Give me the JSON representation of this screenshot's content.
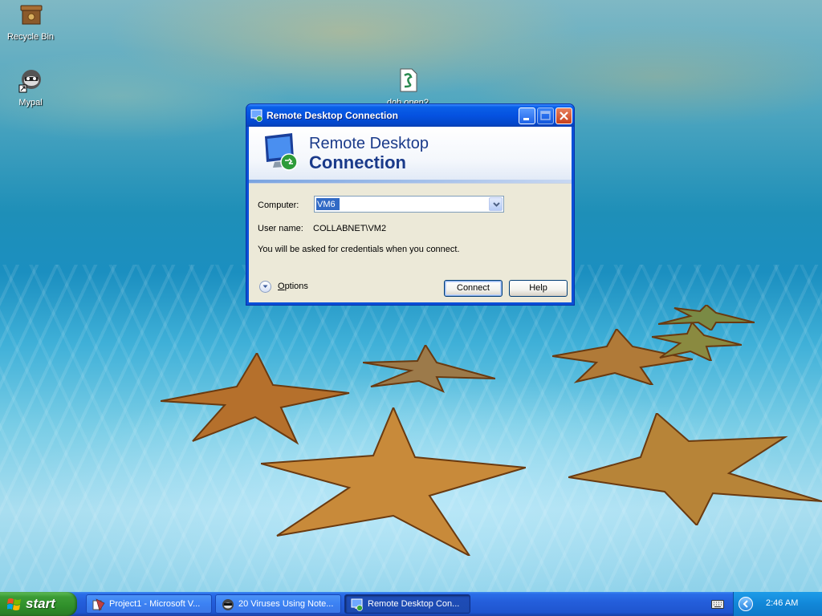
{
  "desktop": {
    "icons": [
      {
        "label": "Recycle Bin",
        "icon": "recycle-bin-icon"
      },
      {
        "label": "Mypal",
        "icon": "mypal-icon"
      },
      {
        "label": "doh.open?",
        "icon": "script-file-icon"
      }
    ]
  },
  "dialog": {
    "title": "Remote Desktop Connection",
    "banner_line1": "Remote Desktop",
    "banner_line2": "Connection",
    "computer_label": "Computer:",
    "computer_value": "VM6",
    "username_label": "User name:",
    "username_value": "COLLABNET\\VM2",
    "info_text": "You will be asked for credentials when you connect.",
    "options_label": "ptions",
    "options_mnemonic": "O",
    "connect_label": "Connect",
    "help_label": "Help"
  },
  "taskbar": {
    "start_label": "start",
    "tasks": [
      {
        "label": "Project1 - Microsoft V...",
        "icon": "visual-basic-icon",
        "active": false
      },
      {
        "label": "20 Viruses Using Note...",
        "icon": "mypal-browser-icon",
        "active": false
      },
      {
        "label": "Remote Desktop Con...",
        "icon": "remote-desktop-icon",
        "active": true
      }
    ],
    "clock": "2:46 AM"
  },
  "colors": {
    "titlebar": "#0552e0",
    "dialog_face": "#ece9d8",
    "banner_text": "#1a3a8a",
    "taskbar": "#245edb",
    "start_button": "#3c9c36",
    "tray": "#1287d8"
  }
}
